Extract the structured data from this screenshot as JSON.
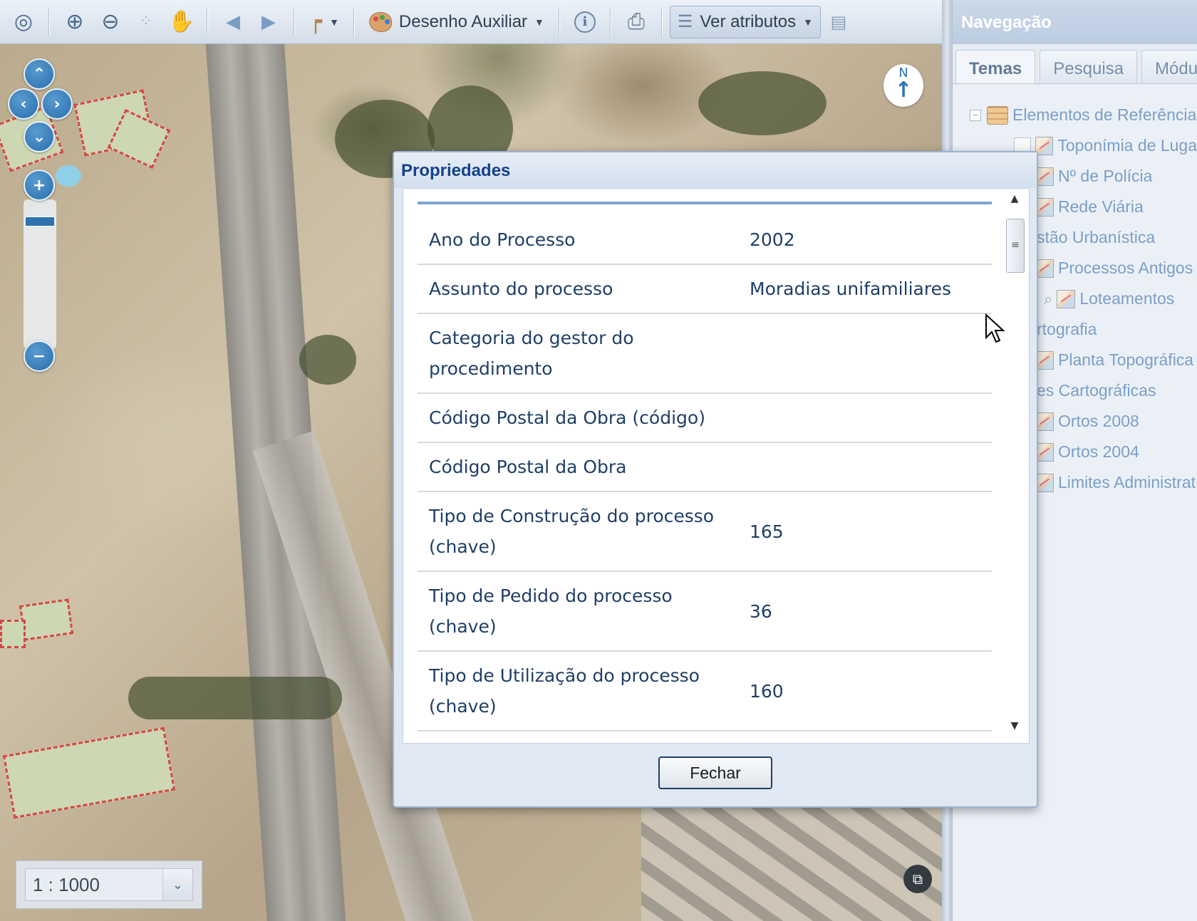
{
  "toolbar": {
    "desenho_label": "Desenho Auxiliar",
    "atributos_label": "Ver atributos"
  },
  "map": {
    "scale_value": "1 : 1000",
    "north_label": "N"
  },
  "nav_panel": {
    "title": "Navegação",
    "tabs": [
      {
        "label": "Temas"
      },
      {
        "label": "Pesquisa"
      },
      {
        "label": "Módu"
      }
    ],
    "tree": [
      {
        "label": "Elementos de Referência"
      },
      {
        "label": "Toponímia de Luga"
      },
      {
        "label": "Nº de Polícia"
      },
      {
        "label": "Rede Viária"
      },
      {
        "label": "stão Urbanística"
      },
      {
        "label": "Processos Antigos"
      },
      {
        "label": "Loteamentos"
      },
      {
        "label": "rtografia"
      },
      {
        "label": "Planta Topográfica"
      },
      {
        "label": "es Cartográficas"
      },
      {
        "label": "Ortos 2008"
      },
      {
        "label": "Ortos 2004"
      },
      {
        "label": "Limites Administrat"
      }
    ]
  },
  "dialog": {
    "title": "Propriedades",
    "close_label": "Fechar",
    "properties": [
      {
        "name": "Ano do Processo",
        "value": "2002"
      },
      {
        "name": "Assunto do processo",
        "value": "Moradias unifamiliares"
      },
      {
        "name": "Categoria do gestor do procedimento",
        "value": ""
      },
      {
        "name": "Código Postal da Obra (código)",
        "value": ""
      },
      {
        "name": "Código Postal da Obra",
        "value": ""
      },
      {
        "name": "Tipo de Construção do processo (chave)",
        "value": "165"
      },
      {
        "name": "Tipo de Pedido do processo (chave)",
        "value": "36"
      },
      {
        "name": "Tipo de Utilização do processo (chave)",
        "value": "160"
      }
    ]
  }
}
